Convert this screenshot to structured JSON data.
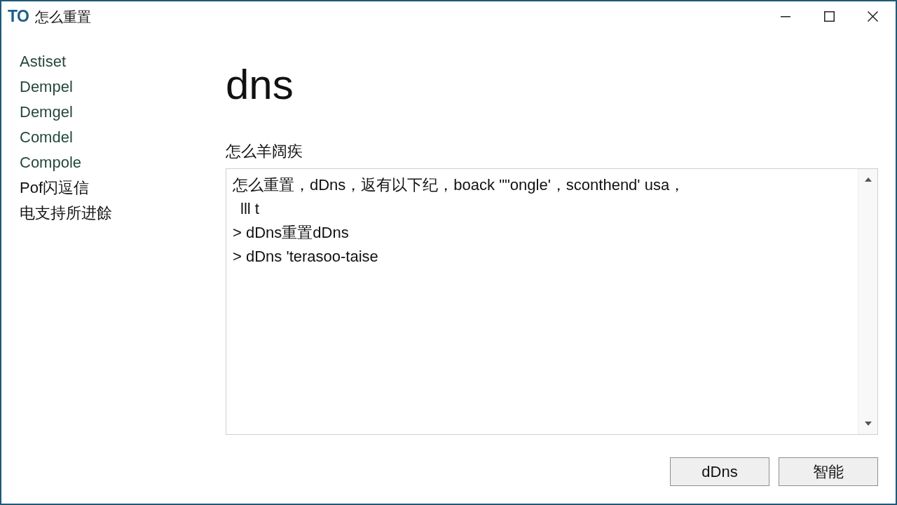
{
  "window": {
    "title_badge": "TO",
    "title": "怎么重置"
  },
  "sidebar": {
    "items": [
      {
        "label": "Astiset",
        "color": "#24483c"
      },
      {
        "label": "Dempel",
        "color": "#24483c"
      },
      {
        "label": "Demgel",
        "color": "#24483c"
      },
      {
        "label": "Comdel",
        "color": "#24483c"
      },
      {
        "label": "Compole",
        "color": "#24483c"
      },
      {
        "label": "Pof闪逗信",
        "color": "#111111"
      },
      {
        "label": "电支持所进餘",
        "color": "#111111"
      }
    ]
  },
  "main": {
    "heading": "dns",
    "section_label": "怎么羊阔疾",
    "text_area": {
      "lines": [
        {
          "text": "怎么重置，dDns，返有以下纪，boack \"\"ongle'，sconthend' usa，",
          "indented": false
        },
        {
          "text": "lll t",
          "indented": true
        },
        {
          "text": "> dDns重置dDns",
          "indented": false
        },
        {
          "text": "> dDns 'terasoo-taise",
          "indented": false
        }
      ]
    }
  },
  "buttons": [
    {
      "label": "dDns"
    },
    {
      "label": "智能"
    }
  ]
}
